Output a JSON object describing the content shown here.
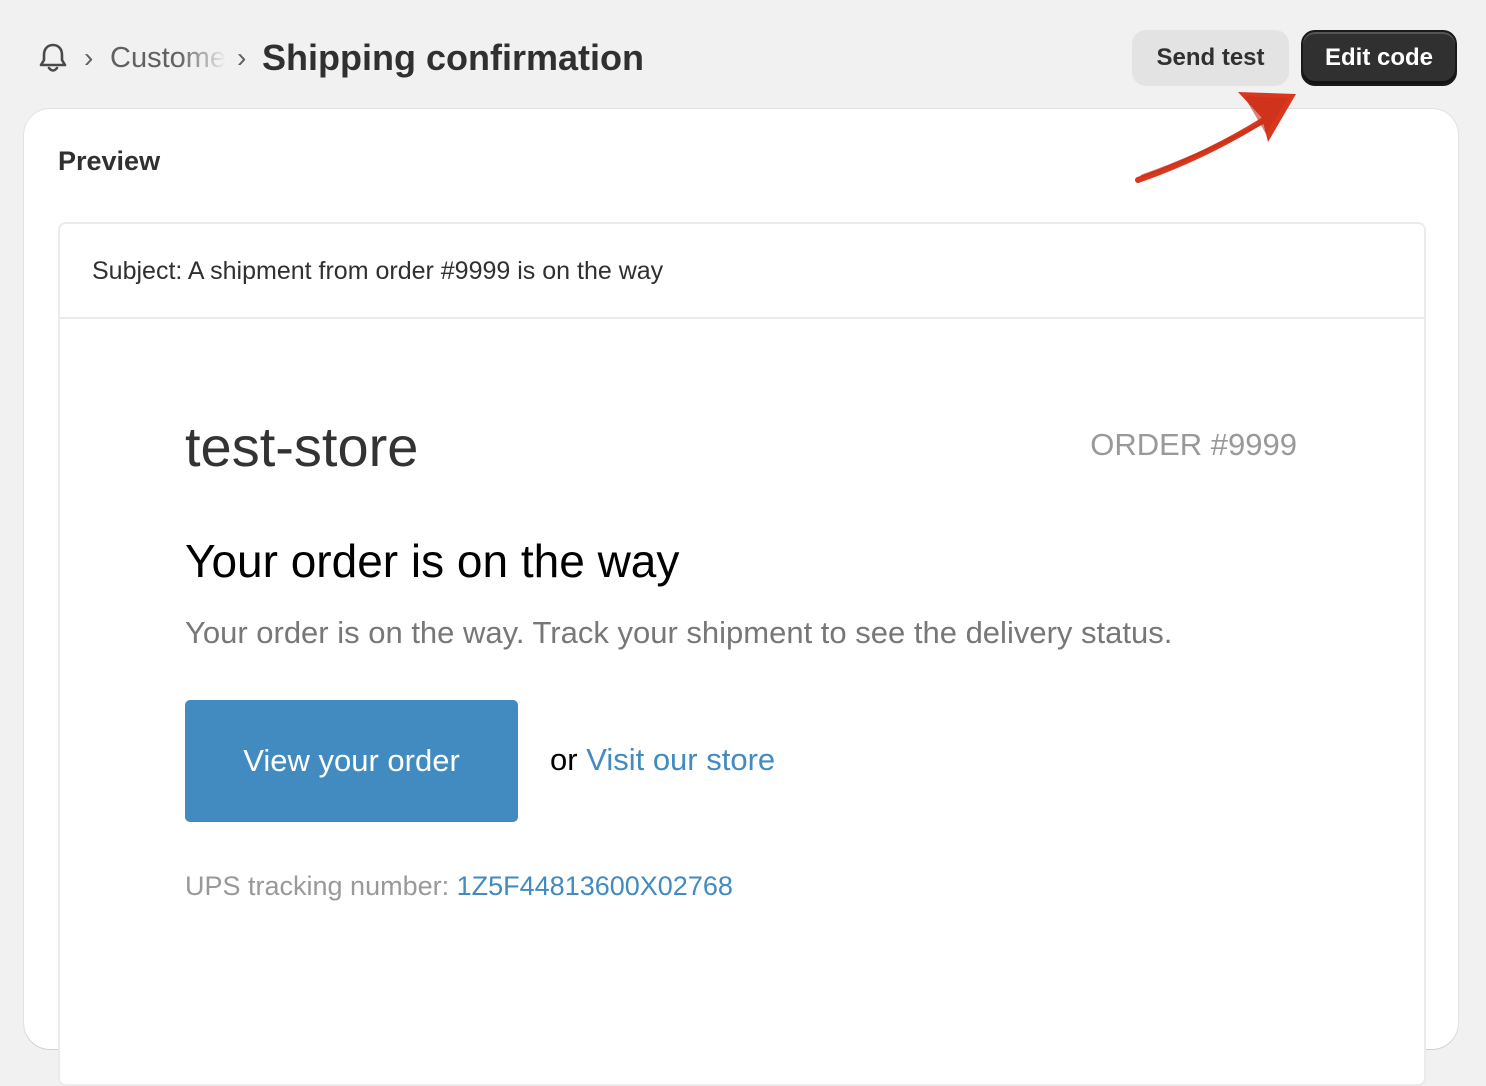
{
  "breadcrumb": {
    "parent": "Customer notifications",
    "separator": "›"
  },
  "header": {
    "title": "Shipping confirmation",
    "send_test_label": "Send test",
    "edit_code_label": "Edit code"
  },
  "preview": {
    "title": "Preview",
    "subject": "Subject: A shipment from order #9999 is on the way"
  },
  "email": {
    "store_name": "test-store",
    "order_number": "ORDER #9999",
    "heading": "Your order is on the way",
    "body": "Your order is on the way. Track your shipment to see the delivery status.",
    "cta_label": "View your order",
    "or_text": "or",
    "visit_store_label": "Visit our store",
    "tracking_label": "UPS tracking number:",
    "tracking_number": "1Z5F44813600X02768"
  },
  "colors": {
    "page_background": "#f1f1f1",
    "primary_button": "#303030",
    "secondary_button": "#e3e3e3",
    "email_accent": "#428bc1",
    "annotation_arrow": "#d9381e"
  },
  "icons": {
    "breadcrumb_root": "bell-icon",
    "annotation": "red-arrow-annotation"
  }
}
